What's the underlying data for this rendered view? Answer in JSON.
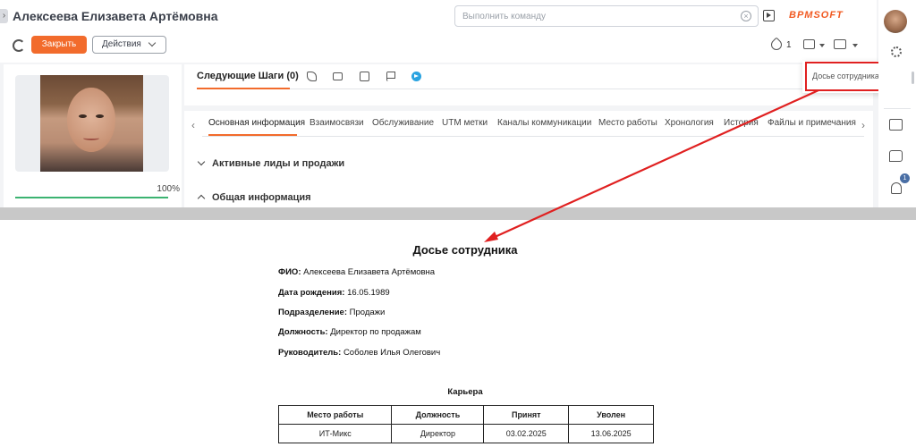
{
  "header": {
    "title": "Алексеева Елизавета Артёмовна",
    "search_placeholder": "Выполнить команду",
    "logo": "BPMSOFT"
  },
  "toolbar": {
    "close_label": "Закрыть",
    "actions_label": "Действия",
    "tag_count": "1"
  },
  "profile": {
    "completion": "100%",
    "completion_fraction": 1.0
  },
  "next_steps": {
    "title": "Следующие Шаги (0)"
  },
  "tabs": [
    "Основная информация",
    "Взаимосвязи",
    "Обслуживание",
    "UTM метки",
    "Каналы коммуникации",
    "Место работы",
    "Хронология",
    "История",
    "Файлы и примечания"
  ],
  "sections": {
    "leads": "Активные лиды и продажи",
    "general": "Общая информация"
  },
  "print_menu": {
    "item": "Досье сотрудника"
  },
  "rail": {
    "notification_count": "1"
  },
  "document": {
    "title": "Досье сотрудника",
    "fields": [
      {
        "label": "ФИО:",
        "value": "Алексеева Елизавета Артёмовна"
      },
      {
        "label": "Дата рождения:",
        "value": "16.05.1989"
      },
      {
        "label": "Подразделение:",
        "value": "Продажи"
      },
      {
        "label": "Должность:",
        "value": "Директор по продажам"
      },
      {
        "label": "Руководитель:",
        "value": "Соболев Илья Олегович"
      }
    ],
    "career_title": "Карьера",
    "career_headers": [
      "Место работы",
      "Должность",
      "Принят",
      "Уволен"
    ],
    "career_rows": [
      [
        "ИТ-Микс",
        "Директор",
        "03.02.2025",
        "13.06.2025"
      ]
    ]
  },
  "colors": {
    "accent": "#f26b2c",
    "highlight": "#e02020",
    "progress": "#3cb371"
  }
}
